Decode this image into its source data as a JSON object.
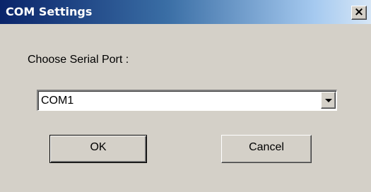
{
  "window": {
    "title": "COM Settings",
    "close_glyph": "×"
  },
  "form": {
    "port_label": "Choose Serial Port :",
    "port_value": "COM1"
  },
  "buttons": {
    "ok_label": "OK",
    "cancel_label": "Cancel"
  },
  "icons": {
    "close": "close-icon",
    "dropdown": "chevron-down-icon"
  },
  "colors": {
    "titlebar_start": "#0a246a",
    "titlebar_end": "#d6e6f6",
    "face": "#d4d0c8"
  }
}
